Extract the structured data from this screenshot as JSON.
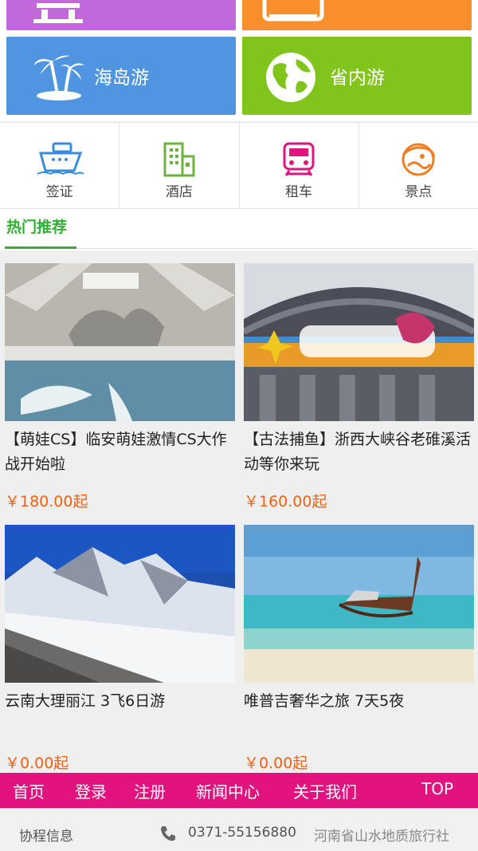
{
  "categories": [
    {
      "label": "",
      "color": "#c169db",
      "icon": "temple-icon"
    },
    {
      "label": "",
      "color": "#f88f2b",
      "icon": "bus-icon"
    },
    {
      "label": "海岛游",
      "color": "#4f95e0",
      "icon": "palm-island-icon"
    },
    {
      "label": "省内游",
      "color": "#80c41c",
      "icon": "globe-icon"
    }
  ],
  "quick_links": [
    {
      "label": "签证",
      "icon": "ship-icon",
      "color": "#3a8bdc"
    },
    {
      "label": "酒店",
      "icon": "building-icon",
      "color": "#6cb33e"
    },
    {
      "label": "租车",
      "icon": "train-icon",
      "color": "#e0137f"
    },
    {
      "label": "景点",
      "icon": "scenic-icon",
      "color": "#f07d22"
    }
  ],
  "section": {
    "title": "热门推荐"
  },
  "products": [
    {
      "name": "【萌娃CS】临安萌娃激情CS大作战开始啦",
      "price": "￥180.00起"
    },
    {
      "name": "【古法捕鱼】浙西大峡谷老碓溪活动等你来玩",
      "price": "￥160.00起"
    },
    {
      "name": "云南大理丽江 3飞6日游",
      "price": "￥0.00起"
    },
    {
      "name": "唯普吉奢华之旅 7天5夜",
      "price": "￥0.00起"
    }
  ],
  "nav": {
    "home": "首页",
    "login": "登录",
    "register": "注册",
    "news": "新闻中心",
    "about": "关于我们",
    "top": "TOP"
  },
  "footer": {
    "brand": "协程信息",
    "phone": "0371-55156880",
    "company": "河南省山水地质旅行社"
  },
  "colors": {
    "accent": "#2eb030",
    "nav_bg": "#e0137f",
    "price": "#f4600f"
  }
}
